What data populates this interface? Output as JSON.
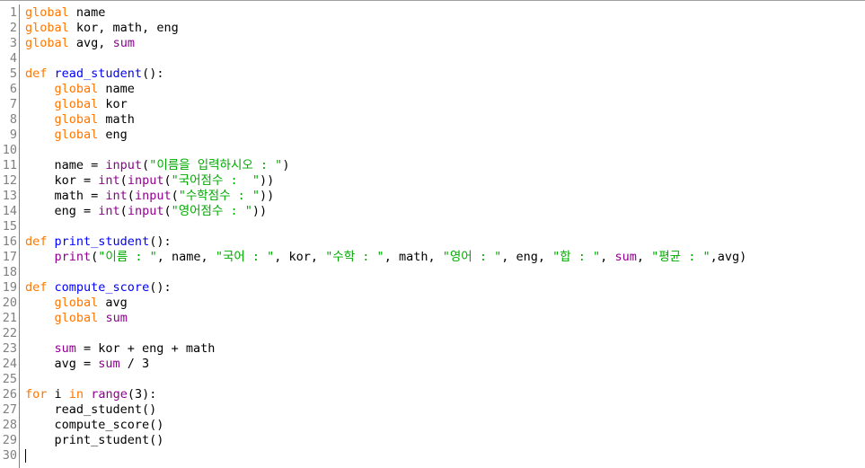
{
  "colors": {
    "kw": "#ff7700",
    "def": "#0000ff",
    "bi": "#900090",
    "str": "#00aa00",
    "plain": "#000000",
    "line_number": "#808080"
  },
  "lines": [
    {
      "n": "1",
      "tokens": [
        [
          "kw",
          "global"
        ],
        [
          "plain",
          " name"
        ]
      ]
    },
    {
      "n": "2",
      "tokens": [
        [
          "kw",
          "global"
        ],
        [
          "plain",
          " kor, math, eng"
        ]
      ]
    },
    {
      "n": "3",
      "tokens": [
        [
          "kw",
          "global"
        ],
        [
          "plain",
          " avg, "
        ],
        [
          "bi",
          "sum"
        ]
      ]
    },
    {
      "n": "4",
      "tokens": []
    },
    {
      "n": "5",
      "tokens": [
        [
          "kw",
          "def"
        ],
        [
          "plain",
          " "
        ],
        [
          "def",
          "read_student"
        ],
        [
          "plain",
          "():"
        ]
      ]
    },
    {
      "n": "6",
      "tokens": [
        [
          "plain",
          "    "
        ],
        [
          "kw",
          "global"
        ],
        [
          "plain",
          " name"
        ]
      ]
    },
    {
      "n": "7",
      "tokens": [
        [
          "plain",
          "    "
        ],
        [
          "kw",
          "global"
        ],
        [
          "plain",
          " kor"
        ]
      ]
    },
    {
      "n": "8",
      "tokens": [
        [
          "plain",
          "    "
        ],
        [
          "kw",
          "global"
        ],
        [
          "plain",
          " math"
        ]
      ]
    },
    {
      "n": "9",
      "tokens": [
        [
          "plain",
          "    "
        ],
        [
          "kw",
          "global"
        ],
        [
          "plain",
          " eng"
        ]
      ]
    },
    {
      "n": "10",
      "tokens": []
    },
    {
      "n": "11",
      "tokens": [
        [
          "plain",
          "    name = "
        ],
        [
          "bi",
          "input"
        ],
        [
          "plain",
          "("
        ],
        [
          "str",
          "\"이름을 입력하시오 : \""
        ],
        [
          "plain",
          ")"
        ]
      ]
    },
    {
      "n": "12",
      "tokens": [
        [
          "plain",
          "    kor = "
        ],
        [
          "bi",
          "int"
        ],
        [
          "plain",
          "("
        ],
        [
          "bi",
          "input"
        ],
        [
          "plain",
          "("
        ],
        [
          "str",
          "\"국어점수 :  \""
        ],
        [
          "plain",
          "))"
        ]
      ]
    },
    {
      "n": "13",
      "tokens": [
        [
          "plain",
          "    math = "
        ],
        [
          "bi",
          "int"
        ],
        [
          "plain",
          "("
        ],
        [
          "bi",
          "input"
        ],
        [
          "plain",
          "("
        ],
        [
          "str",
          "\"수학점수 : \""
        ],
        [
          "plain",
          "))"
        ]
      ]
    },
    {
      "n": "14",
      "tokens": [
        [
          "plain",
          "    eng = "
        ],
        [
          "bi",
          "int"
        ],
        [
          "plain",
          "("
        ],
        [
          "bi",
          "input"
        ],
        [
          "plain",
          "("
        ],
        [
          "str",
          "\"영어점수 : \""
        ],
        [
          "plain",
          "))"
        ]
      ]
    },
    {
      "n": "15",
      "tokens": []
    },
    {
      "n": "16",
      "tokens": [
        [
          "kw",
          "def"
        ],
        [
          "plain",
          " "
        ],
        [
          "def",
          "print_student"
        ],
        [
          "plain",
          "():"
        ]
      ]
    },
    {
      "n": "17",
      "tokens": [
        [
          "plain",
          "    "
        ],
        [
          "bi",
          "print"
        ],
        [
          "plain",
          "("
        ],
        [
          "str",
          "\"이름 : \""
        ],
        [
          "plain",
          ", name, "
        ],
        [
          "str",
          "\"국어 : \""
        ],
        [
          "plain",
          ", kor, "
        ],
        [
          "str",
          "\"수학 : \""
        ],
        [
          "plain",
          ", math, "
        ],
        [
          "str",
          "\"영어 : \""
        ],
        [
          "plain",
          ", eng, "
        ],
        [
          "str",
          "\"합 : \""
        ],
        [
          "plain",
          ", "
        ],
        [
          "bi",
          "sum"
        ],
        [
          "plain",
          ", "
        ],
        [
          "str",
          "\"평균 : \""
        ],
        [
          "plain",
          ",avg)"
        ]
      ]
    },
    {
      "n": "18",
      "tokens": []
    },
    {
      "n": "19",
      "tokens": [
        [
          "kw",
          "def"
        ],
        [
          "plain",
          " "
        ],
        [
          "def",
          "compute_score"
        ],
        [
          "plain",
          "():"
        ]
      ]
    },
    {
      "n": "20",
      "tokens": [
        [
          "plain",
          "    "
        ],
        [
          "kw",
          "global"
        ],
        [
          "plain",
          " avg"
        ]
      ]
    },
    {
      "n": "21",
      "tokens": [
        [
          "plain",
          "    "
        ],
        [
          "kw",
          "global"
        ],
        [
          "plain",
          " "
        ],
        [
          "bi",
          "sum"
        ]
      ]
    },
    {
      "n": "22",
      "tokens": []
    },
    {
      "n": "23",
      "tokens": [
        [
          "plain",
          "    "
        ],
        [
          "bi",
          "sum"
        ],
        [
          "plain",
          " = kor + eng + math"
        ]
      ]
    },
    {
      "n": "24",
      "tokens": [
        [
          "plain",
          "    avg = "
        ],
        [
          "bi",
          "sum"
        ],
        [
          "plain",
          " / 3"
        ]
      ]
    },
    {
      "n": "25",
      "tokens": []
    },
    {
      "n": "26",
      "tokens": [
        [
          "kw",
          "for"
        ],
        [
          "plain",
          " i "
        ],
        [
          "kw",
          "in"
        ],
        [
          "plain",
          " "
        ],
        [
          "bi",
          "range"
        ],
        [
          "plain",
          "(3):"
        ]
      ]
    },
    {
      "n": "27",
      "tokens": [
        [
          "plain",
          "    read_student()"
        ]
      ]
    },
    {
      "n": "28",
      "tokens": [
        [
          "plain",
          "    compute_score()"
        ]
      ]
    },
    {
      "n": "29",
      "tokens": [
        [
          "plain",
          "    print_student()"
        ]
      ]
    },
    {
      "n": "30",
      "tokens": []
    }
  ]
}
